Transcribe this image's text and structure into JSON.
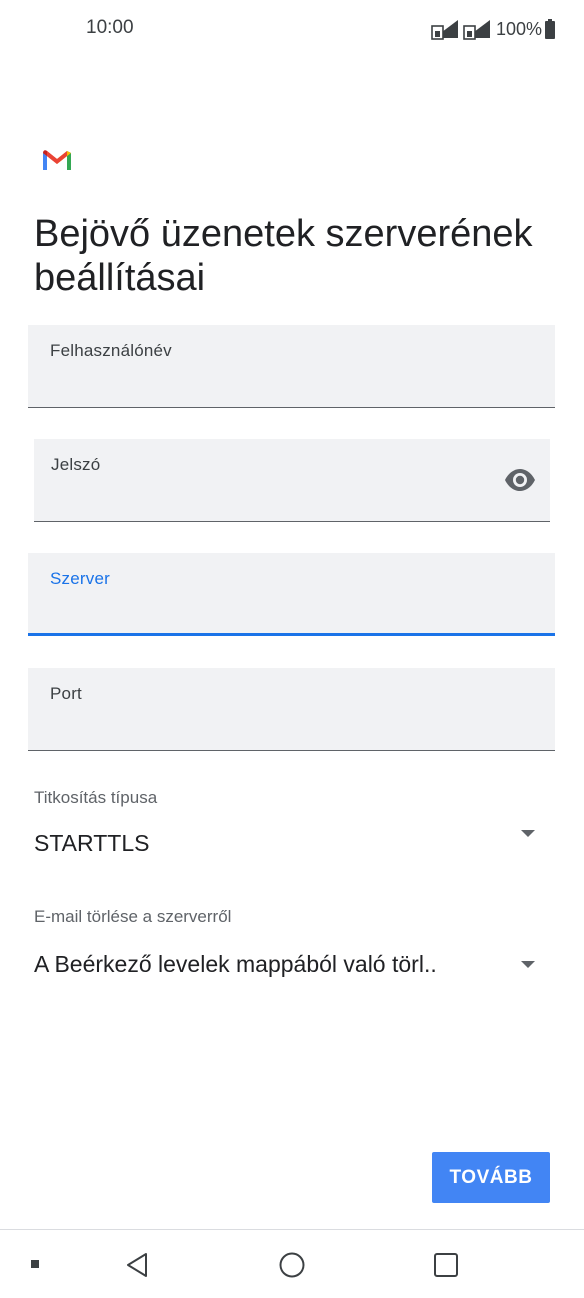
{
  "status_bar": {
    "time": "10:00",
    "battery": "100%",
    "icons": [
      "signal-sim1-icon",
      "signal-sim2-icon",
      "battery-icon"
    ]
  },
  "app": {
    "logo_icon": "gmail-logo-icon",
    "title": "Bejövő üzenetek szerverének beállításai"
  },
  "form": {
    "username_label": "Felhasználónév",
    "username_value": "",
    "password_label": "Jelszó",
    "password_value": "",
    "password_toggle_icon": "eye-icon",
    "server_label": "Szerver",
    "server_value": "",
    "port_label": "Port",
    "port_value": "",
    "encryption_label": "Titkosítás típusa",
    "encryption_value": "STARTTLS",
    "delete_label": "E-mail törlése a szerverről",
    "delete_value": "A Beérkező levelek mappából való törl.."
  },
  "actions": {
    "next_label": "TOVÁBB"
  },
  "colors": {
    "accent": "#1a73e8",
    "button": "#4285f4",
    "field_bg": "#f1f2f4"
  },
  "nav_bar": {
    "icons": [
      "recents-dot-icon",
      "back-icon",
      "home-icon",
      "overview-icon"
    ]
  }
}
